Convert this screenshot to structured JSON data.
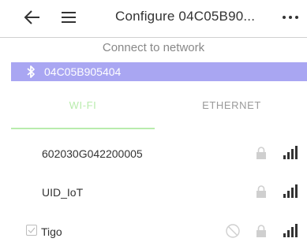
{
  "appbar": {
    "title": "Configure 04C05B90...",
    "back_icon": "arrow-left-icon",
    "menu_icon": "hamburger-menu-icon",
    "more_icon": "more-horizontal-icon"
  },
  "subheader": {
    "text": "Connect to network"
  },
  "device": {
    "icon": "bluetooth-icon",
    "name": "04C05B905404",
    "highlight_color": "#a9a6f2"
  },
  "tabs": {
    "wifi_label": "WI-FI",
    "ethernet_label": "ETHERNET",
    "active": "wifi",
    "active_color": "#b9ecad"
  },
  "networks": [
    {
      "ssid": "602030G042200005",
      "locked": true,
      "signal": "full",
      "checkbox": false,
      "blocked": false
    },
    {
      "ssid": "UID_IoT",
      "locked": true,
      "signal": "full",
      "checkbox": false,
      "blocked": false
    },
    {
      "ssid": "Tigo",
      "locked": true,
      "signal": "full",
      "checkbox": true,
      "blocked": true
    }
  ]
}
